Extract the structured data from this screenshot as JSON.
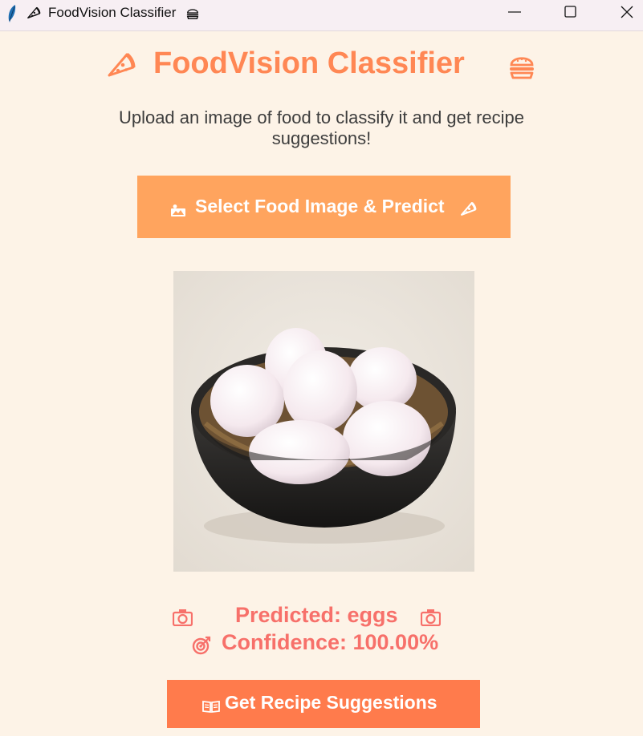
{
  "window": {
    "title": "FoodVision Classifier",
    "icons": [
      "feather-icon",
      "pizza-icon",
      "burger-icon"
    ],
    "controls": [
      "minimize-icon",
      "maximize-icon",
      "close-icon"
    ]
  },
  "header": {
    "title": "FoodVision Classifier",
    "left_icon": "pizza-icon",
    "right_icon": "burger-icon"
  },
  "subtitle": "Upload an image of food to classify it and get recipe suggestions!",
  "select_button": {
    "label": "Select Food Image & Predict",
    "left_icon": "picture-icon",
    "right_icon": "pizza-icon"
  },
  "preview": {
    "image": "eggs-in-bowl"
  },
  "result": {
    "prediction": "Predicted: eggs",
    "confidence": "Confidence: 100.00%",
    "prediction_icons": [
      "food-plate-icon",
      "food-plate-icon"
    ],
    "confidence_icon": "target-icon"
  },
  "recipe_button": {
    "label": "Get Recipe Suggestions",
    "icon": "book-icon"
  },
  "colors": {
    "background": "#fdf3e7",
    "title": "#ff8754",
    "select_button": "#ffa45e",
    "recipe_button": "#ff7b4c",
    "result_text": "#f7706a"
  }
}
